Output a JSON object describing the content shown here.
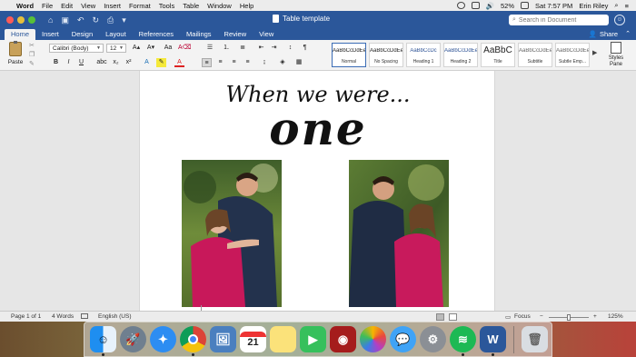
{
  "menubar": {
    "app_name": "Word",
    "items": [
      "File",
      "Edit",
      "View",
      "Insert",
      "Format",
      "Tools",
      "Table",
      "Window",
      "Help"
    ],
    "battery": "52%",
    "clock": "Sat 7:57 PM",
    "user": "Erin Riley"
  },
  "titlebar": {
    "doc_title": "Table template",
    "search_placeholder": "Search in Document"
  },
  "tabs": [
    "Home",
    "Insert",
    "Design",
    "Layout",
    "References",
    "Mailings",
    "Review",
    "View"
  ],
  "share_label": "Share",
  "ribbon": {
    "paste_label": "Paste",
    "font_name": "Calibri (Body)",
    "font_size": "12",
    "styles": [
      {
        "sample": "AaBbCcDdEe",
        "name": "Normal"
      },
      {
        "sample": "AaBbCcDdEe",
        "name": "No Spacing"
      },
      {
        "sample": "AaBbCcDc",
        "name": "Heading 1"
      },
      {
        "sample": "AaBbCcDdEe",
        "name": "Heading 2"
      },
      {
        "sample": "AaBbC",
        "name": "Title"
      },
      {
        "sample": "AaBbCcDdEe",
        "name": "Subtitle"
      },
      {
        "sample": "AaBbCcDdEe",
        "name": "Subtle Emp..."
      }
    ],
    "styles_pane_line1": "Styles",
    "styles_pane_line2": "Pane"
  },
  "document": {
    "headline": "When we were...",
    "big_word": "one"
  },
  "statusbar": {
    "page": "Page 1 of 1",
    "words": "4 Words",
    "language": "English (US)",
    "focus": "Focus",
    "zoom": "125%"
  },
  "dock": [
    "Finder",
    "Launchpad",
    "Safari",
    "Chrome",
    "Preview",
    "Calendar",
    "Notes",
    "FaceTime",
    "Photo Booth",
    "Photos",
    "Messages",
    "System Preferences",
    "Spotify",
    "Word",
    "Trash"
  ],
  "calendar_day": "21"
}
